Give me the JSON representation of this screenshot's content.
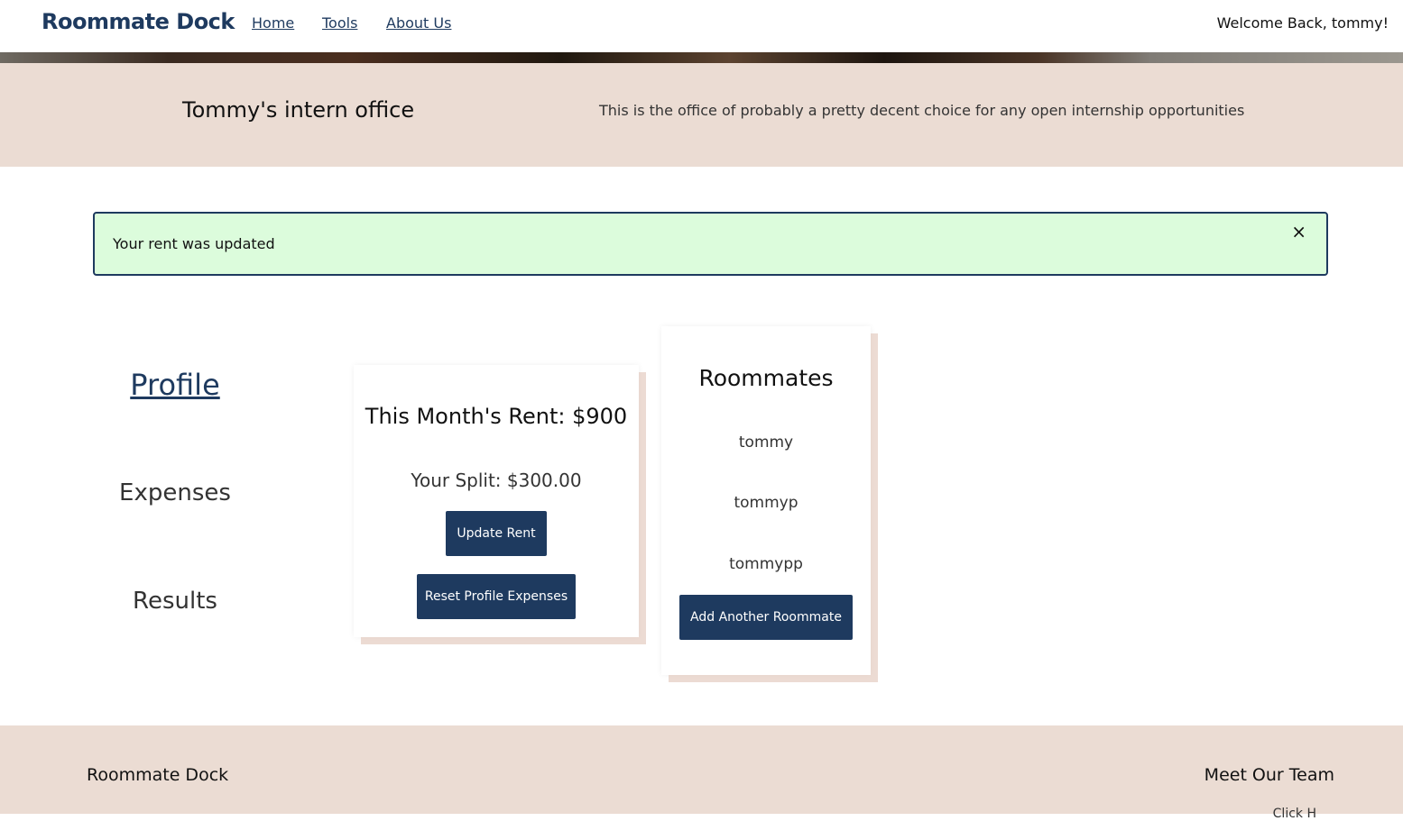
{
  "nav": {
    "brand": "Roommate Dock",
    "links": [
      "Home",
      "Tools",
      "About Us"
    ],
    "welcome": "Welcome Back, tommy!"
  },
  "hero": {
    "title": "Tommy's intern office",
    "description": "This is the office of probably a pretty decent choice for any open internship opportunities"
  },
  "alert": {
    "message": "Your rent was updated",
    "close": "×"
  },
  "sidebar": {
    "items": [
      "Profile",
      "Expenses",
      "Results"
    ],
    "active": "Profile"
  },
  "rent_card": {
    "title": "This Month's Rent: $900",
    "split": "Your Split: $300.00",
    "update_label": "Update Rent",
    "reset_label": "Reset Profile Expenses"
  },
  "roommates_card": {
    "title": "Roommates",
    "names": [
      "tommy",
      "tommyp",
      "tommypp"
    ],
    "add_label": "Add Another Roommate"
  },
  "footer": {
    "brand": "Roommate Dock",
    "team": "Meet Our Team",
    "partial": "Click H"
  },
  "colors": {
    "accent": "#1e3a5f",
    "hero_bg": "#ebdcd3",
    "alert_bg": "#dcfcdc"
  }
}
